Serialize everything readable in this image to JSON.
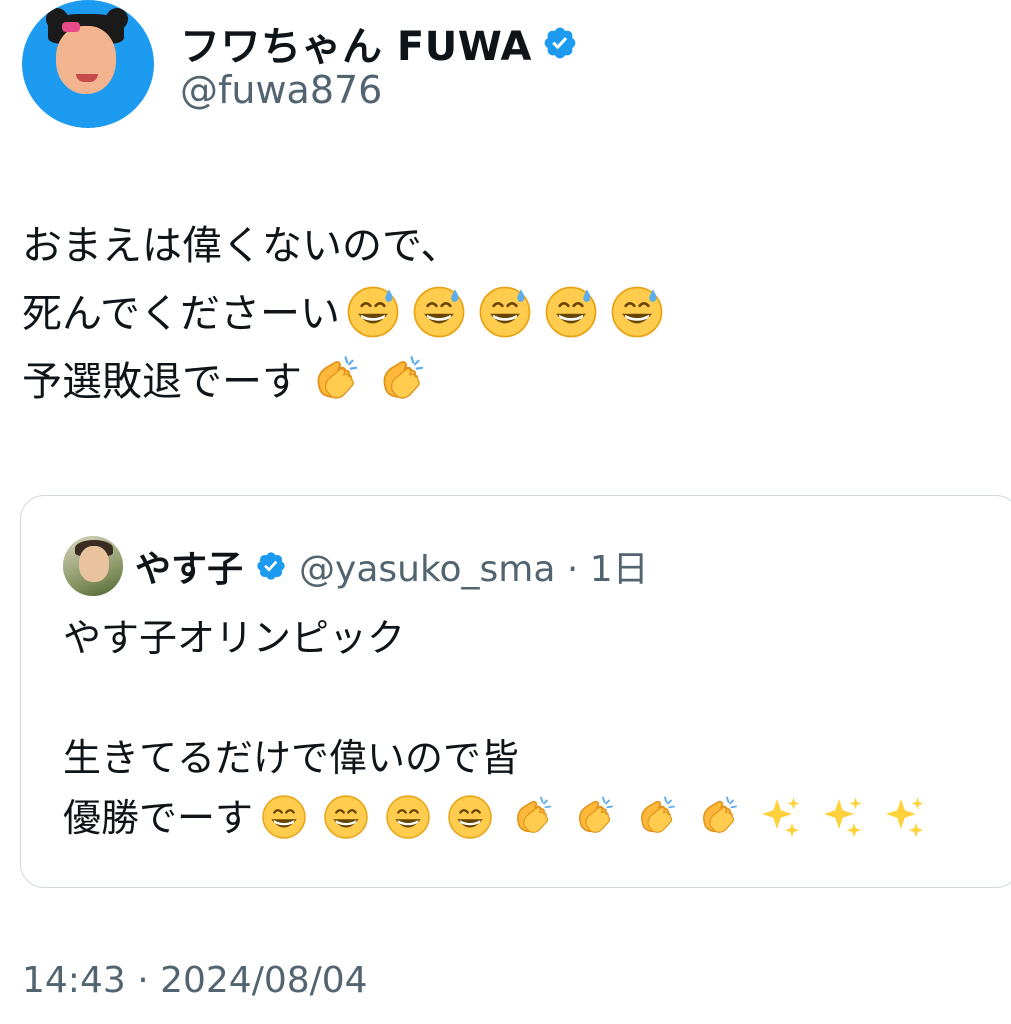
{
  "author": {
    "display_name": "フワちゃん FUWA",
    "handle": "@fuwa876",
    "verified": true,
    "avatar": "profile-photo-blue-background"
  },
  "tweet": {
    "lines": [
      {
        "text": "おまえは偉くないので、",
        "emojis": []
      },
      {
        "text": "死んでくださーい",
        "emojis": [
          "grinning-sweat-emoji",
          "grinning-sweat-emoji",
          "grinning-sweat-emoji",
          "grinning-sweat-emoji",
          "grinning-sweat-emoji"
        ]
      },
      {
        "text": "予選敗退でーす",
        "emojis": [
          "clapping-hands-emoji",
          "clapping-hands-emoji"
        ]
      }
    ]
  },
  "quoted_tweet": {
    "display_name": "やす子",
    "handle_and_time": "@yasuko_sma · 1日",
    "verified": true,
    "lines": [
      {
        "text": "やす子オリンピック",
        "emojis": []
      },
      {
        "text": "",
        "emojis": []
      },
      {
        "text": "生きてるだけで偉いので皆",
        "emojis": []
      },
      {
        "text": "優勝でーす",
        "emojis": [
          "grinning-emoji",
          "grinning-emoji",
          "grinning-emoji",
          "grinning-emoji",
          "clapping-hands-emoji",
          "clapping-hands-emoji",
          "clapping-hands-emoji",
          "clapping-hands-emoji",
          "sparkles-emoji",
          "sparkles-emoji",
          "sparkles-emoji"
        ]
      }
    ]
  },
  "timestamp": "14:43 · 2024/08/04",
  "colors": {
    "verified_blue": "#1d9bf0",
    "secondary_text": "#536471",
    "border": "#cfd9de"
  }
}
